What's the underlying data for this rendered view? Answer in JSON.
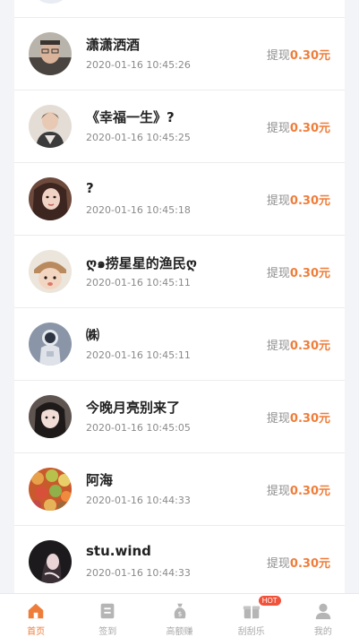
{
  "list": {
    "amount_prefix": "提现",
    "records": [
      {
        "name": "潇潇洒酒",
        "time": "2020-01-16 10:45:26",
        "amount": "0.30元"
      },
      {
        "name": "《幸福一生》?",
        "time": "2020-01-16 10:45:25",
        "amount": "0.30元"
      },
      {
        "name": "?",
        "time": "2020-01-16 10:45:18",
        "amount": "0.30元"
      },
      {
        "name": "ღ๑捞星星的渔民ღ",
        "time": "2020-01-16 10:45:11",
        "amount": "0.30元"
      },
      {
        "name": "㈱",
        "time": "2020-01-16 10:45:11",
        "amount": "0.30元"
      },
      {
        "name": "今晚月亮别来了",
        "time": "2020-01-16 10:45:05",
        "amount": "0.30元"
      },
      {
        "name": "阿海",
        "time": "2020-01-16 10:44:33",
        "amount": "0.30元"
      },
      {
        "name": "stu.wind",
        "time": "2020-01-16 10:44:33",
        "amount": "0.30元"
      }
    ]
  },
  "tabbar": {
    "items": [
      {
        "label": "首页",
        "icon": "home-icon",
        "active": true
      },
      {
        "label": "签到",
        "icon": "sign-in-icon",
        "active": false
      },
      {
        "label": "高额赚",
        "icon": "money-bag-icon",
        "active": false
      },
      {
        "label": "刮刮乐",
        "icon": "scratch-card-icon",
        "active": false,
        "badge": "HOT"
      },
      {
        "label": "我的",
        "icon": "profile-icon",
        "active": false
      }
    ]
  },
  "colors": {
    "accent": "#ef7d3a",
    "badge": "#f0523a",
    "inactive": "#a8a8a8"
  }
}
